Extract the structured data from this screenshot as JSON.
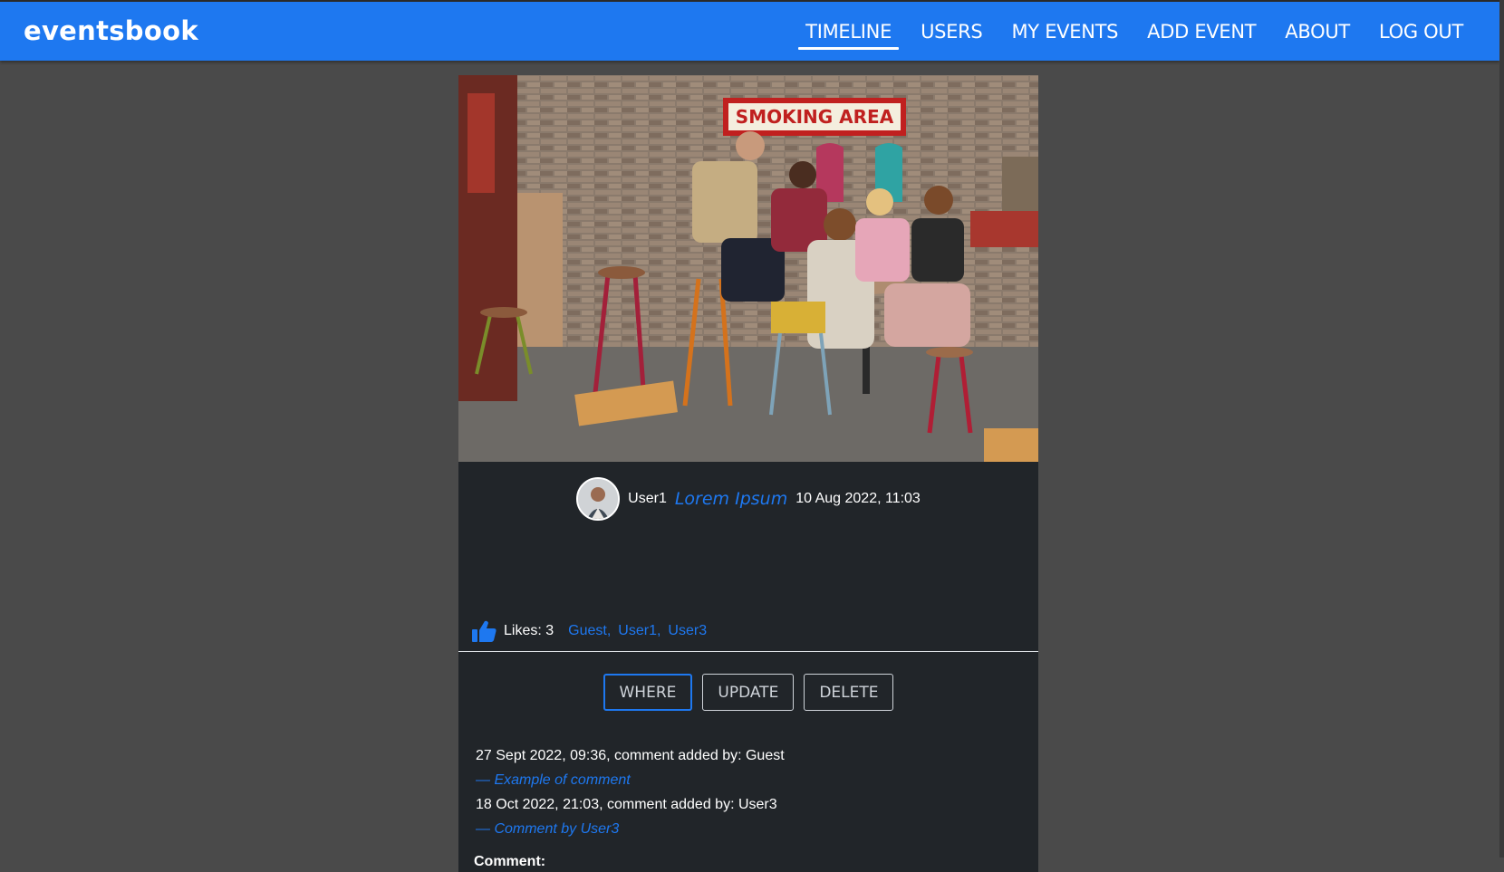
{
  "navbar": {
    "brand": "eventsbook",
    "items": [
      {
        "label": "TIMELINE",
        "active": true
      },
      {
        "label": "USERS"
      },
      {
        "label": "MY EVENTS"
      },
      {
        "label": "ADD EVENT"
      },
      {
        "label": "ABOUT"
      },
      {
        "label": "LOG OUT"
      }
    ]
  },
  "event": {
    "photo_sign": "SMOKING AREA",
    "author": "User1",
    "title": "Lorem Ipsum",
    "date": "10 Aug 2022, 11:03",
    "likes_label": "Likes: 3",
    "likers": [
      "Guest,",
      "User1,",
      "User3"
    ],
    "actions": {
      "where": "WHERE",
      "update": "UPDATE",
      "delete": "DELETE"
    },
    "comments": [
      {
        "meta": "27 Sept 2022, 09:36, comment added by: Guest",
        "text": "— Example of comment"
      },
      {
        "meta": "18 Oct 2022, 21:03, comment added by: User3",
        "text": "— Comment by User3"
      }
    ],
    "comment_form": {
      "label": "Comment:",
      "value": "",
      "placeholder": ""
    }
  },
  "colors": {
    "accent": "#1e78f0",
    "card": "#212529",
    "page": "#4a4a4a"
  },
  "icons": [
    "thumbs-up-icon",
    "user-avatar"
  ]
}
